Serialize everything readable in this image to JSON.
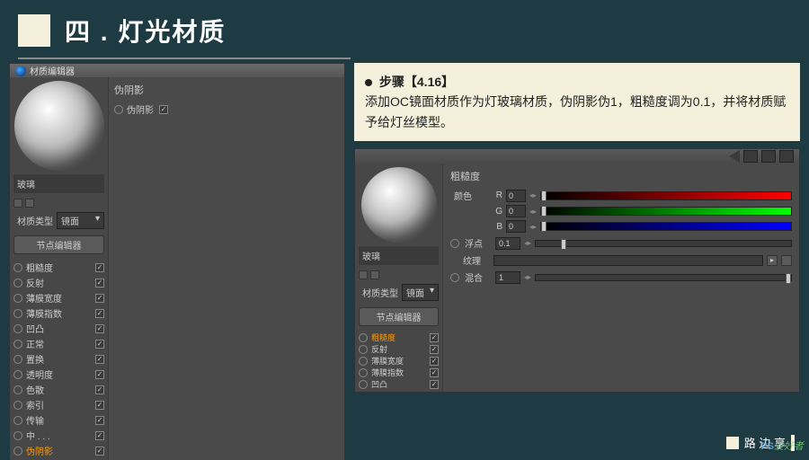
{
  "header": {
    "title": "四 . 灯光材质"
  },
  "desc": {
    "step_label": "步骤【4.16】",
    "text": "添加OC镜面材质作为灯玻璃材质，伪阴影伪1，粗糙度调为0.1，并将材质赋予给灯丝模型。"
  },
  "panel_left": {
    "window_title": "材质编辑器",
    "preview_name": "玻璃",
    "mat_type_label": "材质类型",
    "mat_type_value": "镜面",
    "node_editor_btn": "节点编辑器",
    "right_group_title": "伪阴影",
    "right_group_item": "伪阴影",
    "props": [
      {
        "label": "粗糙度",
        "active": false
      },
      {
        "label": "反射",
        "active": false
      },
      {
        "label": "薄膜宽度",
        "active": false
      },
      {
        "label": "薄膜指数",
        "active": false
      },
      {
        "label": "凹凸",
        "active": false
      },
      {
        "label": "正常",
        "active": false
      },
      {
        "label": "置换",
        "active": false
      },
      {
        "label": "透明度",
        "active": false
      },
      {
        "label": "色散",
        "active": false
      },
      {
        "label": "索引",
        "active": false
      },
      {
        "label": "传输",
        "active": false
      },
      {
        "label": "中 . . .",
        "active": false
      },
      {
        "label": "伪阴影",
        "active": true
      }
    ]
  },
  "panel_right": {
    "preview_name": "玻璃",
    "mat_type_label": "材质类型",
    "mat_type_value": "镜面",
    "node_editor_btn": "节点编辑器",
    "section_title": "粗糙度",
    "props": [
      {
        "label": "粗糙度",
        "active": true
      },
      {
        "label": "反射",
        "active": false
      },
      {
        "label": "薄膜宽度",
        "active": false
      },
      {
        "label": "薄膜指数",
        "active": false
      },
      {
        "label": "凹凸",
        "active": false
      }
    ],
    "color_label": "颜色",
    "rgb": {
      "r": "0",
      "g": "0",
      "b": "0"
    },
    "float_label": "浮点",
    "float_value": "0.1",
    "texture_label": "纹理",
    "mix_label": "混合",
    "mix_value": "1"
  },
  "footer": {
    "author": "路 边 享"
  },
  "watermark": {
    "a": "PS",
    "b": "爱好者"
  }
}
